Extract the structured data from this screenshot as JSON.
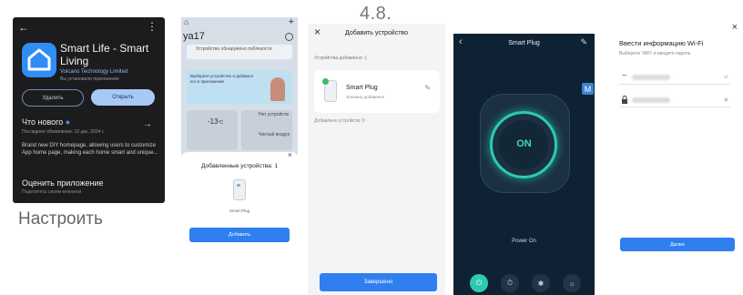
{
  "step_number": "4.8.",
  "setup_caption": "Настроить",
  "screen_store": {
    "back_icon": "←",
    "more_icon": "⋮",
    "app_name": "Smart Life - Smart Living",
    "developer": "Volcano Technology Limited",
    "developer_sub": "Вы установили приложение",
    "uninstall_label": "Удалить",
    "open_label": "Открыть",
    "whats_new": "Что нового",
    "whats_new_dot": "●",
    "arrow_icon": "→",
    "updated": "Последнее обновление: 12 дек. 2024 г.",
    "description": "Brand new DIY homepage, allowing users to customize App home page, making each home smart and unique...",
    "rate_label": "Оценить приложение",
    "rate_sub": "Поделитесь своим мнением"
  },
  "screen_home": {
    "home_icon": "⌂",
    "plus_icon": "+",
    "home_name": "ya17",
    "alert_text": "Устройство обнаружено поблизости",
    "banner_text": "Выберите устройство и добавьте его в приложение",
    "temperature": "-13",
    "temperature_unit": "°C",
    "tile2_a": "Нет устройств",
    "tile2_b": "Чистый воздух",
    "close_icon": "×",
    "added_devices": "Добавленные устройства: 1",
    "plug_caption": "Smart Plug",
    "add_button": "Добавить"
  },
  "screen_add": {
    "close_icon": "×",
    "title": "Добавить устройство",
    "hint": "Устройства добавлено: 1",
    "device_name": "Smart Plug",
    "device_status": "Успешно добавлено",
    "check_icon": "✓",
    "edit_icon": "✎",
    "added_count": "Добавлено устройств: 0",
    "done_button": "Завершено"
  },
  "screen_plug": {
    "back_icon": "‹",
    "title": "Smart Plug",
    "edit_icon": "✎",
    "state": "ON",
    "power_status": "Power On",
    "tab_icons": [
      "⏻",
      "⏱",
      "✱",
      "☼"
    ]
  },
  "badge_letter": "M",
  "screen_wifi": {
    "close_icon": "×",
    "title": "Ввести информацию Wi-Fi",
    "subtitle": "Выберите 'WiFi' и введите пароль",
    "wifi_icon": "⌔",
    "lock_icon": "🔒",
    "swap_icon": "⇄",
    "eye_icon": "◉",
    "next_button": "Далее"
  }
}
